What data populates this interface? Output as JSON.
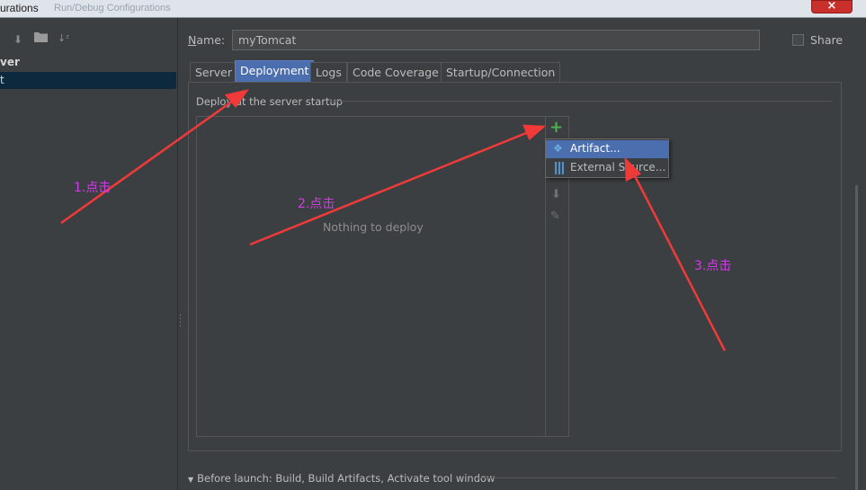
{
  "window": {
    "title": "urations",
    "ghost_text": "Run/Debug Configurations"
  },
  "left_panel": {
    "group_label": "ver",
    "selected_item_label": "t",
    "toolbar_icons": [
      "arrow-down-icon",
      "folder-icon",
      "sort-icon"
    ]
  },
  "name_row": {
    "label": "Name:",
    "value": "myTomcat",
    "share_label": "Share",
    "share_checked": false
  },
  "tabs": [
    {
      "label": "Server",
      "active": false
    },
    {
      "label": "Deployment",
      "active": true
    },
    {
      "label": "Logs",
      "active": false
    },
    {
      "label": "Code Coverage",
      "active": false
    },
    {
      "label": "Startup/Connection",
      "active": false
    }
  ],
  "deployment": {
    "section_title": "Deploy at the server startup",
    "empty_text": "Nothing to deploy"
  },
  "popup_menu": {
    "items": [
      {
        "label": "Artifact...",
        "icon": "artifact-icon",
        "highlighted": true
      },
      {
        "label": "External Source...",
        "icon": "external-source-icon",
        "highlighted": false
      }
    ]
  },
  "before_launch": {
    "label": "Before launch: Build, Build Artifacts, Activate tool window"
  },
  "annotations": {
    "step1": "1.点击",
    "step2": "2.点击",
    "step3": "3.点击",
    "color": "#d23ce6",
    "arrow_color": "#f03a3a"
  },
  "colors": {
    "background": "#3c3f41",
    "accent": "#4b6eaf",
    "add_green": "#4caf50",
    "selection_dark": "#0d293e"
  }
}
